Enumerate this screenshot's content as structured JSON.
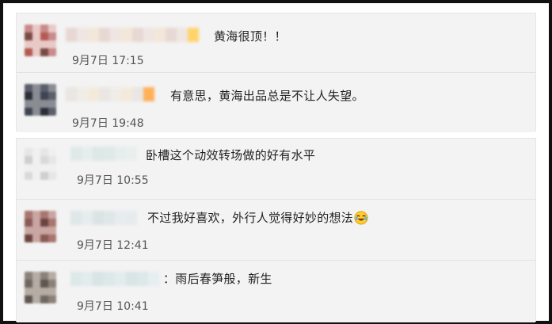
{
  "comments": [
    {
      "text": "黄海很顶！！",
      "time": "9月7日 17:15",
      "avatar_icon": "blurred-avatar",
      "avatar_colors": [
        "#c98a8a",
        "#b35a52",
        "#e9c9c6",
        "#7a4a45"
      ],
      "name_colors": [
        "#e8d8d4",
        "#efe6e2",
        "#f2e7d8",
        "#ffd46a"
      ]
    },
    {
      "text": "有意思，黄海出品总是不让人失望。",
      "time": "9月7日 19:48",
      "avatar_icon": "blurred-avatar",
      "avatar_colors": [
        "#5b5f6a",
        "#3e4452",
        "#8a8c94",
        "#2c2f38"
      ],
      "name_colors": [
        "#e9e6e4",
        "#f0ece6",
        "#f4eadc",
        "#ffb15a"
      ]
    },
    {
      "text": "卧槽这个动效转场做的好有水平",
      "time": "9月7日 10:55",
      "avatar_icon": "blurred-avatar",
      "avatar_colors": [
        "#e6e6e6",
        "#d9d9d9",
        "#f0f0f0",
        "#cfcfcf"
      ],
      "name_colors": [
        "#dfe9e8",
        "#e6eeed",
        "#dde8e7",
        "#e9efee"
      ]
    },
    {
      "text": "不过我好喜欢，外行人觉得好妙的想法",
      "time": "9月7日 12:41",
      "avatar_icon": "blurred-avatar",
      "avatar_colors": [
        "#a97570",
        "#6b4440",
        "#c9a6a2",
        "#8a5a55"
      ],
      "name_colors": [
        "#dfe7e8",
        "#e7ecee",
        "#dbe4e5",
        "#e6ebec"
      ],
      "emoji_icon": "laughing-tears-emoji"
    },
    {
      "text": "：雨后春笋般，新生",
      "time": "9月7日 10:41",
      "avatar_icon": "blurred-avatar",
      "avatar_colors": [
        "#8b8178",
        "#5e5650",
        "#b5aca4",
        "#706860"
      ],
      "name_colors": [
        "#dde8e9",
        "#e3ecec",
        "#d8e4e5",
        "#e6eeee"
      ]
    }
  ],
  "colors": {
    "panel_bg": "#f3f3f3",
    "frame": "#111111",
    "text": "#222222",
    "time": "#555555"
  }
}
